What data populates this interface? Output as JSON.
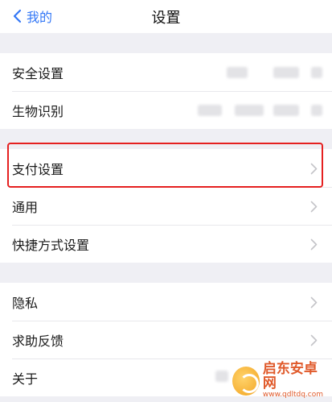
{
  "nav": {
    "back_label": "我的",
    "title": "设置"
  },
  "groups": [
    {
      "items": [
        {
          "label": "安全设置"
        },
        {
          "label": "生物识别"
        }
      ]
    },
    {
      "items": [
        {
          "label": "支付设置",
          "highlighted": true
        },
        {
          "label": "通用"
        },
        {
          "label": "快捷方式设置"
        }
      ]
    },
    {
      "items": [
        {
          "label": "隐私"
        },
        {
          "label": "求助反馈"
        },
        {
          "label": "关于"
        }
      ]
    }
  ],
  "watermark": {
    "text": "启东安卓网",
    "url": "www.qdltdq.com"
  },
  "colors": {
    "accent": "#3478f6",
    "highlight": "#e52020",
    "background": "#efeff4"
  },
  "icons": {
    "back": "chevron-left-icon",
    "row": "chevron-right-icon"
  }
}
